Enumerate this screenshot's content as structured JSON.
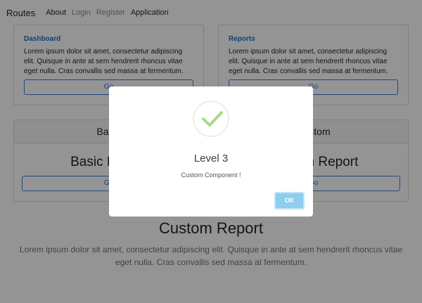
{
  "navbar": {
    "brand": "Routes",
    "links": [
      "About",
      "Login",
      "Register",
      "Application"
    ]
  },
  "top_cards": [
    {
      "title": "Dashboard",
      "text": "Lorem ipsum dolor sit amet, consectetur adipiscing elit. Quisque in ante at sem hendrerit rhoncus vitae eget nulla. Cras convallis sed massa at fermentum.",
      "button": "Go"
    },
    {
      "title": "Reports",
      "text": "Lorem ipsum dolor sit amet, consectetur adipiscing elit. Quisque in ante at sem hendrerit rhoncus vitae eget nulla. Cras convallis sed massa at fermentum.",
      "button": "Go"
    }
  ],
  "mid_cards": [
    {
      "header": "Basic",
      "title": "Basic Report",
      "button": "Go"
    },
    {
      "header": "Custom",
      "title": "Custom Report",
      "button": "Go"
    }
  ],
  "main": {
    "title": "Custom Report",
    "text": "Lorem ipsum dolor sit amet, consectetur adipiscing elit. Quisque in ante at sem hendrerit rhoncus vitae eget nulla. Cras convallis sed massa at fermentum."
  },
  "modal": {
    "icon": "success-check-icon",
    "title": "Level 3",
    "text": "Custom Component !",
    "ok_label": "OK"
  },
  "colors": {
    "link": "#1a6fd1",
    "ok_button": "#8ccdf0",
    "check": "#a5dc86"
  }
}
